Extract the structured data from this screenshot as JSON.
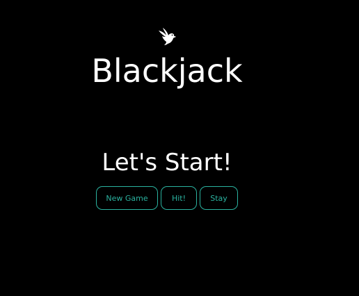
{
  "app": {
    "title": "Blackjack",
    "logo_icon": "bird-icon"
  },
  "game": {
    "status_message": "Let's Start!"
  },
  "controls": {
    "new_game_label": "New Game",
    "hit_label": "Hit!",
    "stay_label": "Stay"
  },
  "colors": {
    "background": "#000000",
    "text": "#ffffff",
    "accent": "#2bb3a0"
  }
}
